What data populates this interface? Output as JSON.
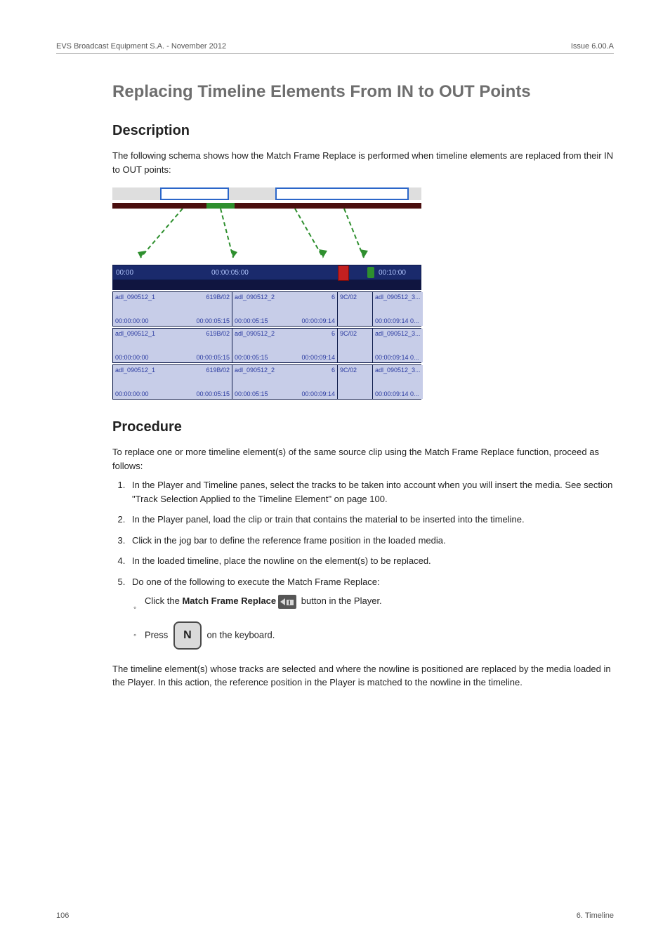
{
  "header": {
    "left": "EVS Broadcast Equipment S.A. - November 2012",
    "right": "Issue 6.00.A"
  },
  "title": "Replacing Timeline Elements From IN to OUT Points",
  "sections": {
    "description": {
      "heading": "Description",
      "para": "The following schema shows how the Match Frame Replace is performed when timeline elements are replaced from their IN to OUT points:"
    },
    "ruler": {
      "t0": "00:00",
      "t1": "00:00:05:00",
      "t2": "00:10:00"
    },
    "tracks": [
      {
        "c1_name": "adl_090512_1",
        "c1_id": "619B/02",
        "c1_in": "00:00:00:00",
        "c1_out": "00:00:05:15",
        "c2_name": "adl_090512_2",
        "c2_id": "6",
        "c2_in": "00:00:05:15",
        "c2_out": "00:00:09:14",
        "c3_id": "9C/02",
        "c4_name": "adl_090512_3...",
        "c4_in": "00:00:09:14 0..."
      },
      {
        "c1_name": "adl_090512_1",
        "c1_id": "619B/02",
        "c1_in": "00:00:00:00",
        "c1_out": "00:00:05:15",
        "c2_name": "adl_090512_2",
        "c2_id": "6",
        "c2_in": "00:00:05:15",
        "c2_out": "00:00:09:14",
        "c3_id": "9C/02",
        "c4_name": "adl_090512_3...",
        "c4_in": "00:00:09:14 0..."
      },
      {
        "c1_name": "adl_090512_1",
        "c1_id": "619B/02",
        "c1_in": "00:00:00:00",
        "c1_out": "00:00:05:15",
        "c2_name": "adl_090512_2",
        "c2_id": "6",
        "c2_in": "00:00:05:15",
        "c2_out": "00:00:09:14",
        "c3_id": "9C/02",
        "c4_name": "adl_090512_3...",
        "c4_in": "00:00:09:14 0..."
      }
    ],
    "procedure": {
      "heading": "Procedure",
      "intro": "To replace one or more timeline element(s) of the same source clip using the Match Frame Replace function, proceed as follows:",
      "steps": [
        "In the Player and Timeline panes, select the tracks to be taken into account when you will insert the media. See section \"Track Selection Applied to the Timeline Element\" on page 100.",
        "In the Player panel, load the clip or train that contains the material to be inserted into the timeline.",
        "Click in the jog bar to define the reference frame position in the loaded media.",
        "In the loaded timeline, place the nowline on the element(s) to be replaced.",
        "Do one of the following to execute the Match Frame Replace:"
      ],
      "sub": {
        "click_prefix": "Click the ",
        "click_bold": "Match Frame Replace",
        "click_suffix": " button in the Player.",
        "press_prefix": "Press ",
        "press_key": "N",
        "press_suffix": " on the keyboard."
      },
      "outro": "The timeline element(s) whose tracks are selected and where the nowline is positioned are replaced by the media loaded in the Player. In this action, the reference position in the Player is matched to the nowline in the timeline."
    }
  },
  "footer": {
    "left": "106",
    "right": "6. Timeline"
  }
}
